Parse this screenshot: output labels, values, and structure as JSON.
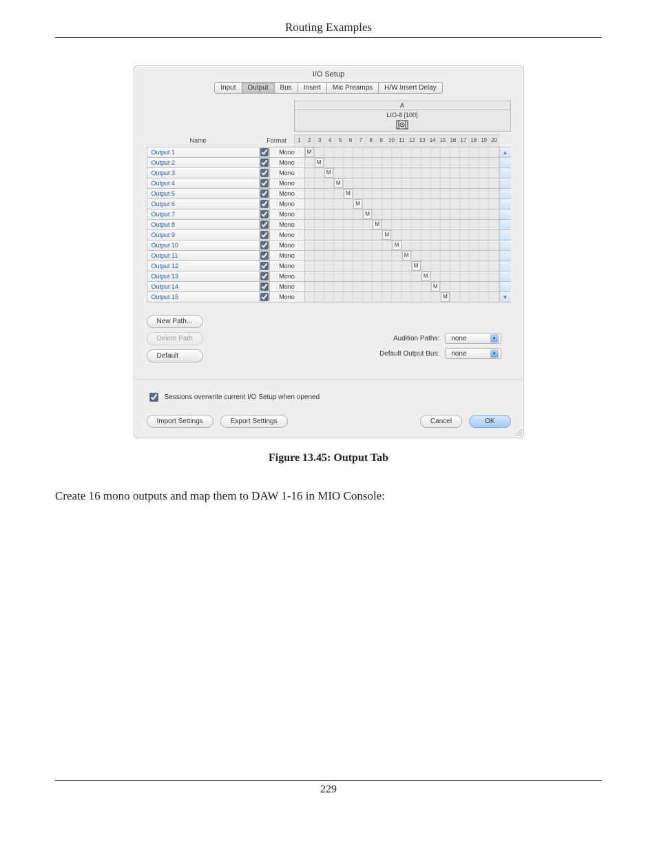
{
  "header_title": "Routing Examples",
  "figure_caption": "Figure 13.45: Output Tab",
  "body_paragraph": "Create 16 mono outputs and map them to DAW 1-16 in MIO Console:",
  "page_number": "229",
  "io_setup": {
    "title": "I/O Setup",
    "tabs": [
      "Input",
      "Output",
      "Bus",
      "Insert",
      "Mic Preamps",
      "H/W Insert Delay"
    ],
    "active_tab_index": 1,
    "device_letter": "A",
    "device_name": "LIO-8 [100]",
    "columns": {
      "name": "Name",
      "format": "Format"
    },
    "channel_numbers": [
      "1",
      "2",
      "3",
      "4",
      "5",
      "6",
      "7",
      "8",
      "9",
      "10",
      "11",
      "12",
      "13",
      "14",
      "15",
      "16",
      "17",
      "18",
      "19",
      "20"
    ],
    "rows": [
      {
        "name": "Output 1",
        "checked": true,
        "format": "Mono",
        "m_at": 1
      },
      {
        "name": "Output 2",
        "checked": true,
        "format": "Mono",
        "m_at": 2
      },
      {
        "name": "Output 3",
        "checked": true,
        "format": "Mono",
        "m_at": 3
      },
      {
        "name": "Output 4",
        "checked": true,
        "format": "Mono",
        "m_at": 4
      },
      {
        "name": "Output 5",
        "checked": true,
        "format": "Mono",
        "m_at": 5
      },
      {
        "name": "Output 6",
        "checked": true,
        "format": "Mono",
        "m_at": 6
      },
      {
        "name": "Output 7",
        "checked": true,
        "format": "Mono",
        "m_at": 7
      },
      {
        "name": "Output 8",
        "checked": true,
        "format": "Mono",
        "m_at": 8
      },
      {
        "name": "Output 9",
        "checked": true,
        "format": "Mono",
        "m_at": 9
      },
      {
        "name": "Output 10",
        "checked": true,
        "format": "Mono",
        "m_at": 10
      },
      {
        "name": "Output 11",
        "checked": true,
        "format": "Mono",
        "m_at": 11
      },
      {
        "name": "Output 12",
        "checked": true,
        "format": "Mono",
        "m_at": 12
      },
      {
        "name": "Output 13",
        "checked": true,
        "format": "Mono",
        "m_at": 13
      },
      {
        "name": "Output 14",
        "checked": true,
        "format": "Mono",
        "m_at": 14
      },
      {
        "name": "Output 15",
        "checked": true,
        "format": "Mono",
        "m_at": 15
      }
    ],
    "grid_marker": "M",
    "buttons": {
      "new_path": "New Path...",
      "delete_path": "Delete Path",
      "default": "Default",
      "import": "Import Settings",
      "export": "Export Settings",
      "cancel": "Cancel",
      "ok": "OK"
    },
    "audition_label": "Audition Paths:",
    "default_output_label": "Default Output Bus:",
    "audition_value": "none",
    "default_output_value": "none",
    "sessions_checkbox_label": "Sessions overwrite current I/O Setup when opened",
    "sessions_checked": true
  }
}
